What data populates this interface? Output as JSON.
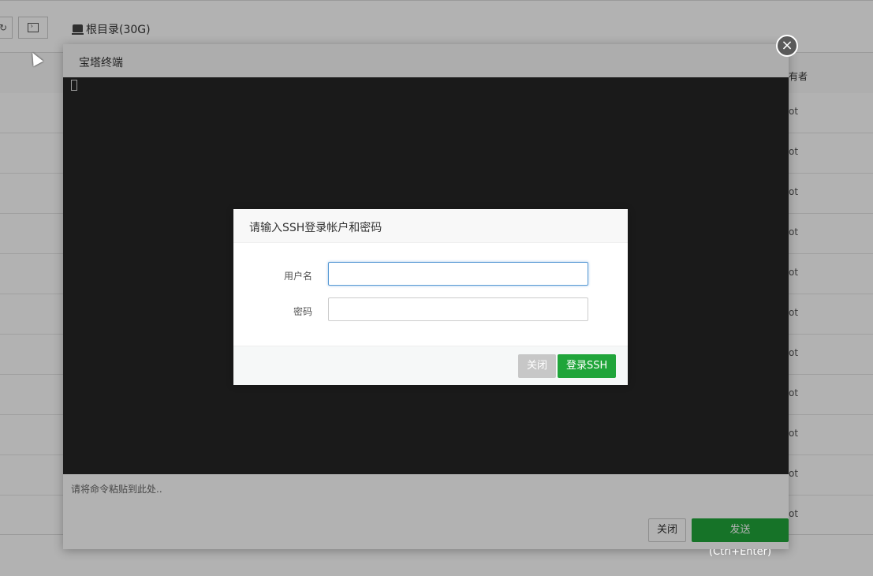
{
  "background": {
    "breadcrumb": "根目录(30G)",
    "owner_column_fragment": "有者",
    "owner_cell_fragment": "ot",
    "row_count": 11
  },
  "terminal_window": {
    "title": "宝塔终端",
    "command_placeholder": "请将命令粘贴到此处..",
    "close_label": "关闭",
    "send_label": "发送(Ctrl+Enter)",
    "close_icon": "close-icon"
  },
  "ssh_dialog": {
    "title": "请输入SSH登录帐户和密码",
    "username_label": "用户名",
    "username_value": "",
    "password_label": "密码",
    "password_value": "",
    "close_label": "关闭",
    "login_label": "登录SSH"
  },
  "colors": {
    "accent_green": "#20a53a",
    "terminal_bg": "#262626",
    "focus_border": "#5b9bd5"
  }
}
